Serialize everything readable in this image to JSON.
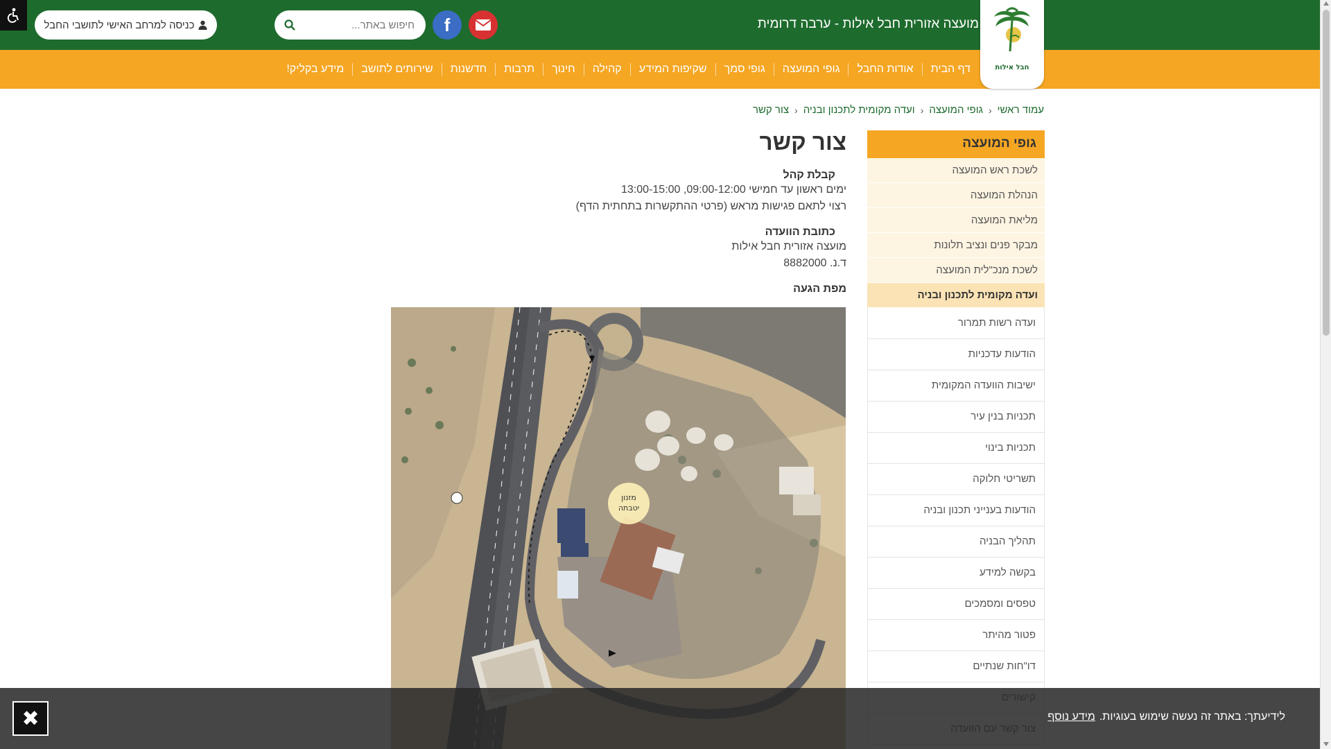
{
  "header": {
    "site_title": "מועצה אזורית חבל אילות - ערבה דרומית",
    "logo_text": "חבל אילות",
    "search_placeholder": "חיפוש באתר...",
    "login_label": "כניסה למרחב האישי לתושבי החבל",
    "facebook_glyph": "f",
    "colors": {
      "green": "#1e6b2e",
      "orange": "#f5a623"
    }
  },
  "nav": {
    "items": [
      "דף הבית",
      "אודות החבל",
      "גופי המועצה",
      "גופי סמך",
      "שקיפות המידע",
      "קהילה",
      "חינוך",
      "תרבות",
      "חדשנות",
      "שירותים לתושב",
      "מידע בקליק!"
    ]
  },
  "breadcrumb": {
    "items": [
      "עמוד ראשי",
      "גופי המועצה",
      "ועדה מקומית לתכנון ובניה",
      "צור קשר"
    ]
  },
  "sidebar": {
    "title": "גופי המועצה",
    "items": [
      "לשכת ראש המועצה",
      "הנהלת המועצה",
      "מליאת המועצה",
      "מבקר פנים ונציב תלונות",
      "לשכת מנכ\"לית המועצה"
    ],
    "sub_title": "ועדה מקומית לתכנון ובניה",
    "sub_items": [
      "ועדה רשות תמרור",
      "הודעות עדכניות",
      "ישיבות הוועדה המקומית",
      "תכניות בנין עיר",
      "תכניות בינוי",
      "תשריטי חלוקה",
      "הודעות בענייני תכנון ובניה",
      "תהליך הבניה",
      "בקשה למידע",
      "טפסים ומסמכים",
      "פטור מהיתר",
      "דו\"חות שנתיים",
      "קישורים",
      "צור קשר עם הוועדה"
    ]
  },
  "main": {
    "title": "צור קשר",
    "reception_heading": "קבלת קהל",
    "reception_line1": "ימים ראשון עד חמישי 09:00-12:00, 13:00-15:00",
    "reception_line2": "רצוי לתאם פגישות מראש (פרטי ההתקשרות בתחתית הדף)",
    "address_heading": "כתובת הוועדה",
    "address_line1": "מועצה אזורית חבל אילות",
    "address_line2": "ד.נ. 8882000",
    "map_heading": "מפת הגעה",
    "map_marker_label": "מזנון יטבתה"
  },
  "cookie": {
    "text": "לידיעתך: באתר זה נעשה שימוש בעוגיות.",
    "link": "מידע נוסף",
    "close_glyph": "✖"
  }
}
